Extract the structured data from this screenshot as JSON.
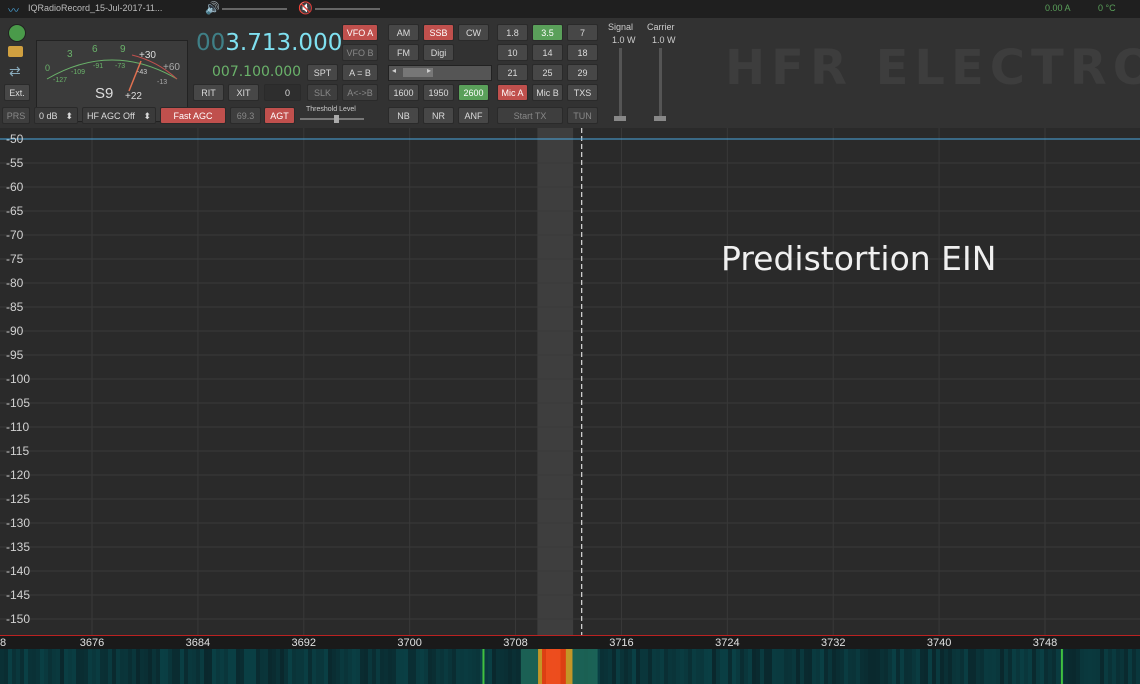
{
  "titlebar": {
    "title": "IQRadioRecord_15-Jul-2017-11...",
    "readout_a": "0.00 A",
    "readout_c": "0 °C"
  },
  "vfo": {
    "main_freq_dim": "00",
    "main_freq": "3.713.000",
    "sub_freq": "007.100.000",
    "rit_value": "0"
  },
  "meter": {
    "reading": "S9",
    "over": "+22",
    "scale_top": [
      "3",
      "6",
      "9",
      "+30",
      "+60"
    ],
    "scale_bottom": [
      "0",
      "-127",
      "-109",
      "-91",
      "-73",
      "-43",
      "-13"
    ]
  },
  "buttons": {
    "vfo_a": "VFO A",
    "vfo_b": "VFO B",
    "spt": "SPT",
    "a_eq_b": "A = B",
    "rit": "RIT",
    "xit": "XIT",
    "slk": "SLK",
    "a_swap_b": "A<->B",
    "am": "AM",
    "ssb": "SSB",
    "cw": "CW",
    "fm": "FM",
    "digi": "Digi",
    "bw1": "1600",
    "bw2": "1950",
    "bw3": "2600",
    "nb": "NB",
    "nr": "NR",
    "anf": "ANF",
    "b18": "1.8",
    "b35": "3.5",
    "b7": "7",
    "b10": "10",
    "b14": "14",
    "b18m": "18",
    "b21": "21",
    "b25": "25",
    "b29": "29",
    "mica": "Mic A",
    "micb": "Mic B",
    "txs": "TXS",
    "start_tx": "Start TX",
    "tun": "TUN",
    "ext": "Ext.",
    "prs": "PRS",
    "fast_agc": "Fast AGC",
    "agt": "AGT"
  },
  "selects": {
    "gain": "0 dB",
    "agc": "HF AGC Off"
  },
  "agt_value": "69.3",
  "threshold_label": "Threshold Level",
  "signal": {
    "label": "Signal",
    "value": "1.0 W"
  },
  "carrier": {
    "label": "Carrier",
    "value": "1.0 W"
  },
  "watermark": "HFR ELECTRO",
  "overlay_text": "Predistortion EIN",
  "spectrum": {
    "y_labels": [
      "-50",
      "-55",
      "-60",
      "-65",
      "-70",
      "-75",
      "-80",
      "-85",
      "-90",
      "-95",
      "-100",
      "-105",
      "-110",
      "-115",
      "-120",
      "-125",
      "-130",
      "-135",
      "-140",
      "-145",
      "-150"
    ],
    "x_labels": [
      "3676",
      "3684",
      "3692",
      "3700",
      "3708",
      "3716",
      "3724",
      "3732",
      "3740",
      "3748"
    ],
    "x_edge": "8"
  },
  "icons": {
    "speaker": "speaker-icon",
    "mute": "mute-icon",
    "power": "power-icon",
    "folder": "folder-icon",
    "sync": "sync-icon"
  },
  "colors": {
    "trace": "#4aa8e0",
    "red_btn": "#c0504d",
    "green_btn": "#5aa05a",
    "freq_cyan": "#7fe0f0",
    "freq_green": "#6ab26a"
  }
}
